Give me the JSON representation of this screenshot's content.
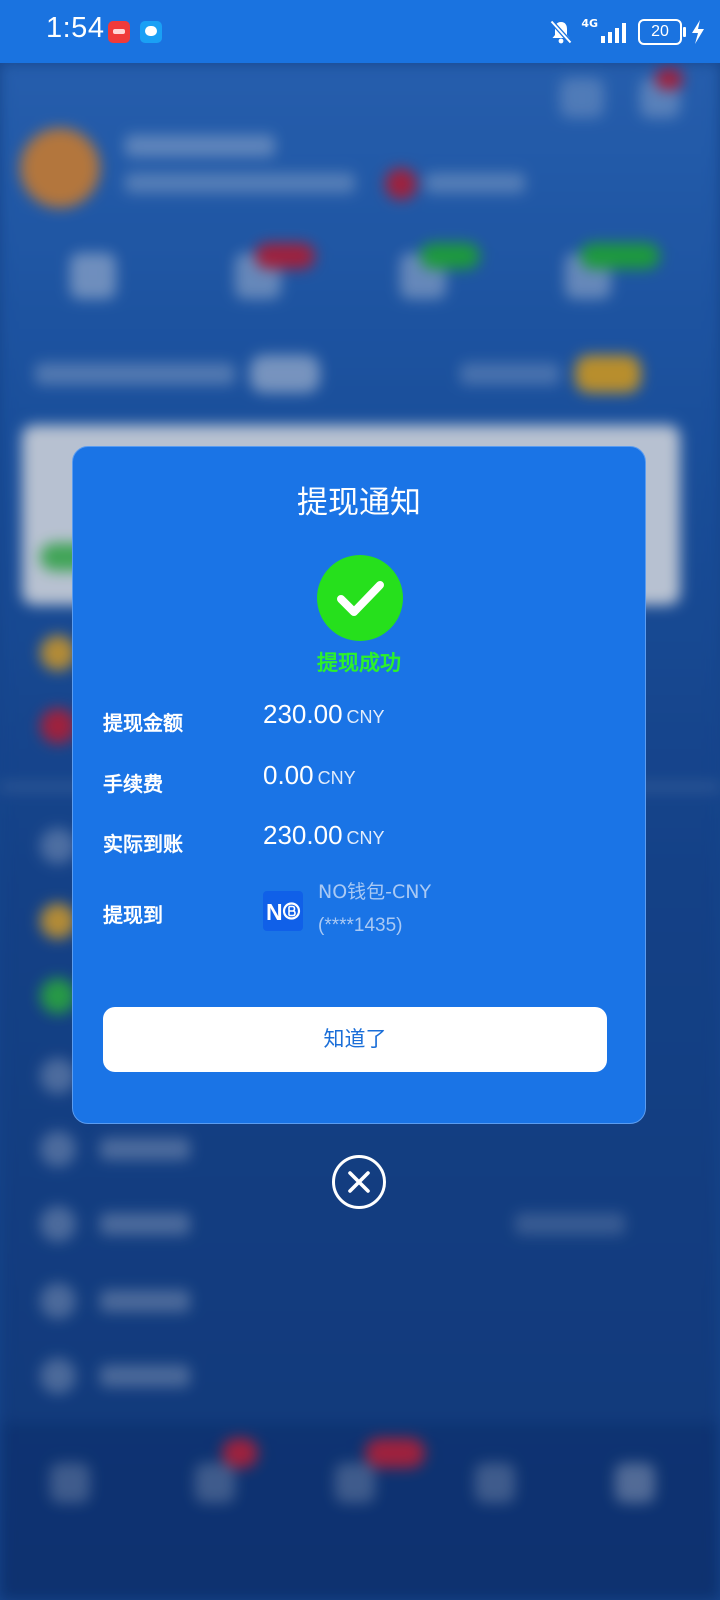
{
  "status_bar": {
    "time": "1:54",
    "network": "4G",
    "battery": "20"
  },
  "dialog": {
    "title": "提现通知",
    "status_text": "提现成功",
    "rows": [
      {
        "label": "提现金额",
        "amount": "230.00",
        "unit": "CNY"
      },
      {
        "label": "手续费",
        "amount": "0.00",
        "unit": "CNY"
      },
      {
        "label": "实际到账",
        "amount": "230.00",
        "unit": "CNY"
      }
    ],
    "destination": {
      "label": "提现到",
      "logo_text": "N",
      "wallet_name": "NO钱包-CNY",
      "account": "(****1435)"
    },
    "confirm_label": "知道了"
  },
  "icons": {
    "success": "check-circle-icon",
    "close": "close-circle-icon"
  },
  "colors": {
    "status_bar": "#1a73e0",
    "dialog_bg": "#1a74e6",
    "success": "#26e01c",
    "button_text": "#1a6ed8"
  }
}
